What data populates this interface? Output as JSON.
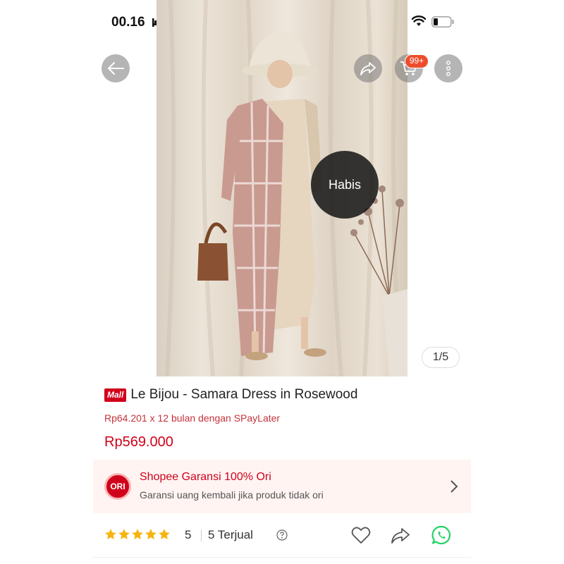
{
  "status": {
    "time": "00.16"
  },
  "gallery": {
    "overlay_label": "Habis",
    "counter": "1/5"
  },
  "cart": {
    "badge": "99+"
  },
  "product": {
    "mall_badge": "Mall",
    "title": "Le Bijou - Samara Dress in Rosewood",
    "installment": "Rp64.201 x 12 bulan dengan SPayLater",
    "price": "Rp569.000"
  },
  "guarantee": {
    "icon_text": "ORI",
    "title": "Shopee Garansi 100% Ori",
    "subtitle": "Garansi uang kembali jika produk tidak ori"
  },
  "rating": {
    "stars": 5,
    "value": "5",
    "sold": "5 Terjual"
  },
  "colors": {
    "accent": "#ee4d2d",
    "price": "#d0011b",
    "whatsapp": "#25d366"
  },
  "icons": [
    "bed-icon",
    "signal-icon",
    "wifi-icon",
    "battery-icon",
    "back-arrow-icon",
    "share-icon",
    "cart-icon",
    "more-vertical-icon",
    "ori-icon",
    "chevron-right-icon",
    "star-icon",
    "help-icon",
    "heart-icon",
    "whatsapp-icon"
  ]
}
